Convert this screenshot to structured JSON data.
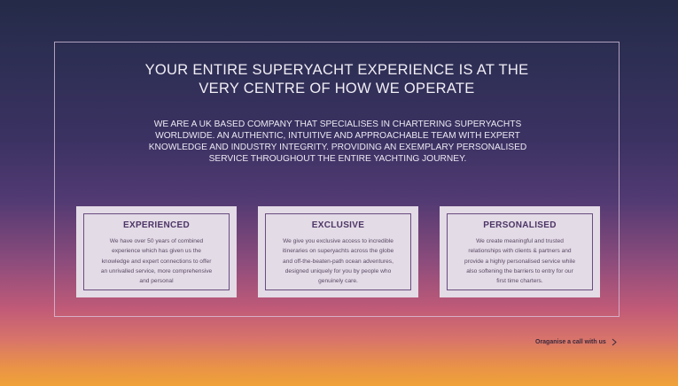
{
  "main": {
    "headline_line1": "YOUR ENTIRE SUPERYACHT EXPERIENCE IS AT THE",
    "headline_line2": "VERY CENTRE OF HOW WE OPERATE",
    "intro": [
      "WE ARE A UK BASED COMPANY THAT SPECIALISES IN CHARTERING SUPERYACHTS",
      "WORLDWIDE. AN AUTHENTIC, INTUITIVE AND APPROACHABLE TEAM WITH EXPERT",
      "KNOWLEDGE AND INDUSTRY INTEGRITY.  PROVIDING AN EXEMPLARY PERSONALISED",
      "SERVICE THROUGHOUT THE ENTIRE YACHTING JOURNEY."
    ]
  },
  "cards": [
    {
      "title": "EXPERIENCED",
      "body": [
        "We have over 50 years of combined",
        "experience which has given us the",
        "knowledge and expert connections to offer",
        "an unrivalled service, more comprehensive",
        "and personal"
      ]
    },
    {
      "title": "EXCLUSIVE",
      "body": [
        "We give you exclusive access to incredible",
        "itineraries on superyachts across the globe",
        "and off-the-beaten-path ocean adventures,",
        "designed uniquely for you by people who",
        "genuinely care."
      ]
    },
    {
      "title": "PERSONALISED",
      "body": [
        "We create meaningful and trusted",
        "relationships with clients & partners and",
        "provide a highly personalised service while",
        "also softening the barriers to entry for our",
        "first time charters."
      ]
    }
  ],
  "cta": {
    "label": "Oraganise a call with us",
    "icon": "chevron-right-icon"
  }
}
